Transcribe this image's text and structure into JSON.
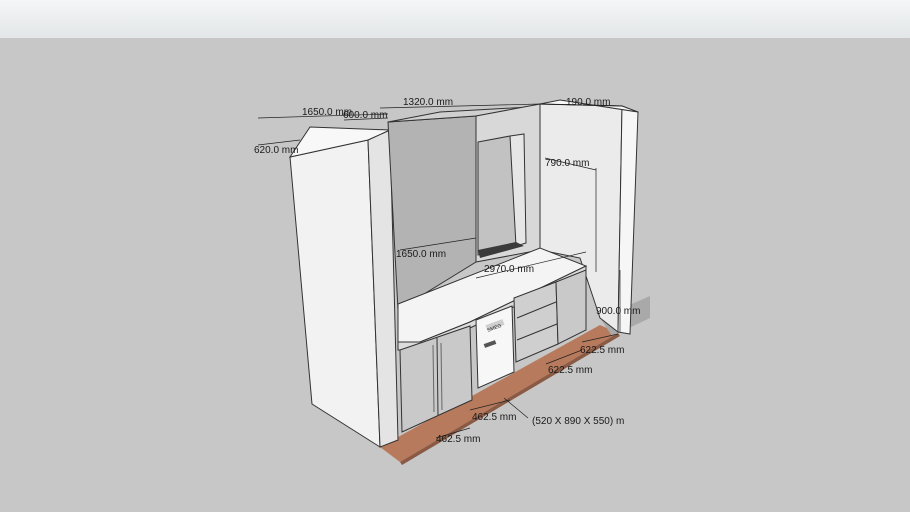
{
  "dimensions": {
    "d_1650_top": "1650.0 mm",
    "d_600": "600.0 mm",
    "d_1320": "1320.0 mm",
    "d_190": "190.0 mm",
    "d_620": "620.0 mm",
    "d_790": "790.0 mm",
    "d_1650_mid": "1650.0 mm",
    "d_2970": "2970.0 mm",
    "d_900": "900.0 mm",
    "d_6225_a": "622.5 mm",
    "d_6225_b": "622.5 mm",
    "d_4625_a": "462.5 mm",
    "d_4625_b": "462.5 mm",
    "fridge_size": "(520 X 890 X 550) m"
  },
  "appliance": {
    "fridge_logo": "SMEG"
  }
}
